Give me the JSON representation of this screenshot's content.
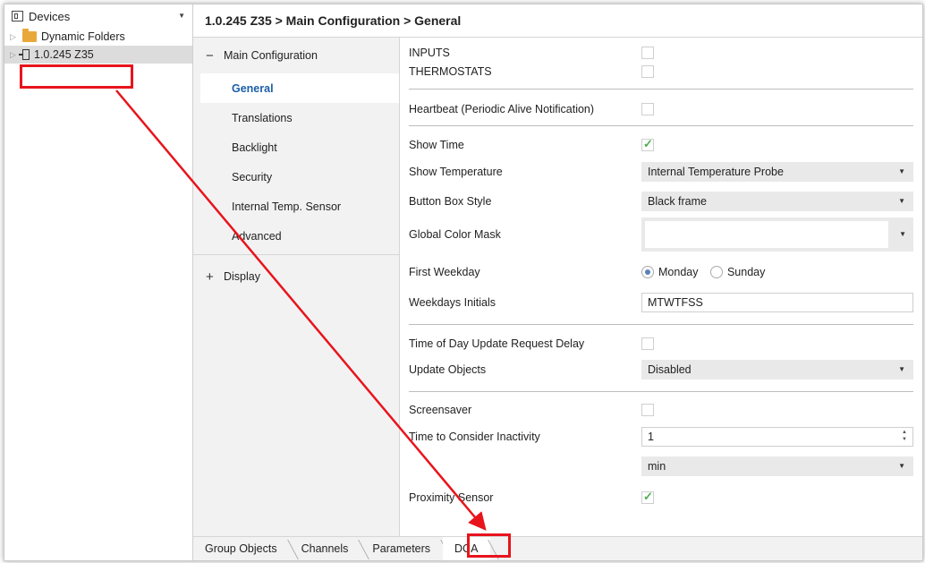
{
  "devices_panel": {
    "title": "Devices",
    "items": [
      {
        "label": "Dynamic Folders"
      },
      {
        "label": "1.0.245 Z35"
      }
    ]
  },
  "breadcrumb": "1.0.245 Z35 > Main Configuration > General",
  "nav": {
    "group1": {
      "sign": "−",
      "label": "Main Configuration"
    },
    "subitems": [
      "General",
      "Translations",
      "Backlight",
      "Security",
      "Internal Temp. Sensor",
      "Advanced"
    ],
    "group2": {
      "sign": "+",
      "label": "Display"
    }
  },
  "params": {
    "inputs": {
      "label": "INPUTS",
      "checked": false
    },
    "thermostats": {
      "label": "THERMOSTATS",
      "checked": false
    },
    "heartbeat": {
      "label": "Heartbeat (Periodic Alive Notification)",
      "checked": false
    },
    "show_time": {
      "label": "Show Time",
      "checked": true
    },
    "show_temperature": {
      "label": "Show Temperature",
      "value": "Internal Temperature Probe"
    },
    "button_box_style": {
      "label": "Button Box Style",
      "value": "Black frame"
    },
    "global_color_mask": {
      "label": "Global Color Mask",
      "value": ""
    },
    "first_weekday": {
      "label": "First Weekday",
      "options": [
        "Monday",
        "Sunday"
      ],
      "selected": "Monday"
    },
    "weekdays_initials": {
      "label": "Weekdays Initials",
      "value": "MTWTFSS"
    },
    "tod_update_delay": {
      "label": "Time of Day Update Request Delay",
      "checked": false
    },
    "update_objects": {
      "label": "Update Objects",
      "value": "Disabled"
    },
    "screensaver": {
      "label": "Screensaver",
      "checked": false
    },
    "inactivity_time": {
      "label": "Time to Consider Inactivity",
      "value": "1"
    },
    "inactivity_unit": {
      "value": "min"
    },
    "proximity_sensor": {
      "label": "Proximity Sensor",
      "checked": true
    }
  },
  "bottom_tabs": [
    "Group Objects",
    "Channels",
    "Parameters",
    "DCA"
  ],
  "annotation_color": "#e8141c"
}
